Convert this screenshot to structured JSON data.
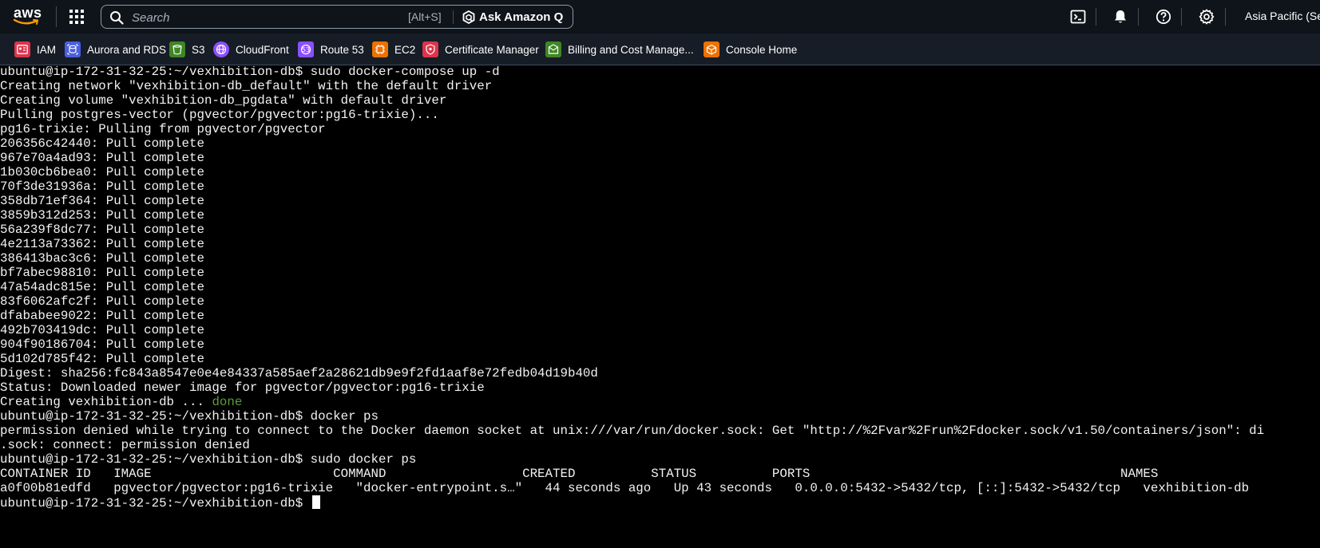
{
  "topnav": {
    "logo_text": "aws",
    "search_placeholder": "Search",
    "search_shortcut": "[Alt+S]",
    "ask_q_label": "Ask Amazon Q",
    "region": "Asia Pacific (Sec"
  },
  "favorites": [
    {
      "label": "IAM",
      "color": "#dd344c",
      "icon": "iam-icon"
    },
    {
      "label": "Aurora and RDS",
      "color": "#4a5fe0",
      "icon": "rds-icon"
    },
    {
      "label": "S3",
      "color": "#3f8624",
      "icon": "s3-icon"
    },
    {
      "label": "CloudFront",
      "color": "#8c4fff",
      "icon": "cloudfront-icon"
    },
    {
      "label": "Route 53",
      "color": "#8c4fff",
      "icon": "route53-icon"
    },
    {
      "label": "EC2",
      "color": "#ed7100",
      "icon": "ec2-icon"
    },
    {
      "label": "Certificate Manager",
      "color": "#dd344c",
      "icon": "certificate-manager-icon"
    },
    {
      "label": "Billing and Cost Manage...",
      "color": "#3f8624",
      "icon": "billing-icon"
    },
    {
      "label": "Console Home",
      "color": "#ed7100",
      "icon": "console-home-icon"
    }
  ],
  "terminal": {
    "lines": [
      "ubuntu@ip-172-31-32-25:~/vexhibition-db$ sudo docker-compose up -d",
      "Creating network \"vexhibition-db_default\" with the default driver",
      "Creating volume \"vexhibition-db_pgdata\" with default driver",
      "Pulling postgres-vector (pgvector/pgvector:pg16-trixie)...",
      "pg16-trixie: Pulling from pgvector/pgvector",
      "206356c42440: Pull complete",
      "967e70a4ad93: Pull complete",
      "1b030cb6bea0: Pull complete",
      "70f3de31936a: Pull complete",
      "358db71ef364: Pull complete",
      "3859b312d253: Pull complete",
      "56a239f8dc77: Pull complete",
      "4e2113a73362: Pull complete",
      "386413bac3c6: Pull complete",
      "bf7abec98810: Pull complete",
      "47a54adc815e: Pull complete",
      "83f6062afc2f: Pull complete",
      "dfababee9022: Pull complete",
      "492b703419dc: Pull complete",
      "904f90186704: Pull complete",
      "5d102d785f42: Pull complete",
      "Digest: sha256:fc843a8547e0e4e84337a585aef2a28621db9e9f2fd1aaf8e72fedb04d19b40d",
      "Status: Downloaded newer image for pgvector/pgvector:pg16-trixie",
      "Creating vexhibition-db ... ",
      "ubuntu@ip-172-31-32-25:~/vexhibition-db$ docker ps",
      "permission denied while trying to connect to the Docker daemon socket at unix:///var/run/docker.sock: Get \"http://%2Fvar%2Frun%2Fdocker.sock/v1.50/containers/json\": di",
      ".sock: connect: permission denied",
      "ubuntu@ip-172-31-32-25:~/vexhibition-db$ sudo docker ps",
      "CONTAINER ID   IMAGE                        COMMAND                  CREATED          STATUS          PORTS                                         NAMES",
      "a0f00b81edfd   pgvector/pgvector:pg16-trixie   \"docker-entrypoint.s…\"   44 seconds ago   Up 43 seconds   0.0.0.0:5432->5432/tcp, [::]:5432->5432/tcp   vexhibition-db",
      "ubuntu@ip-172-31-32-25:~/vexhibition-db$ "
    ],
    "done_word": "done",
    "done_color": "#5c9a3b"
  }
}
